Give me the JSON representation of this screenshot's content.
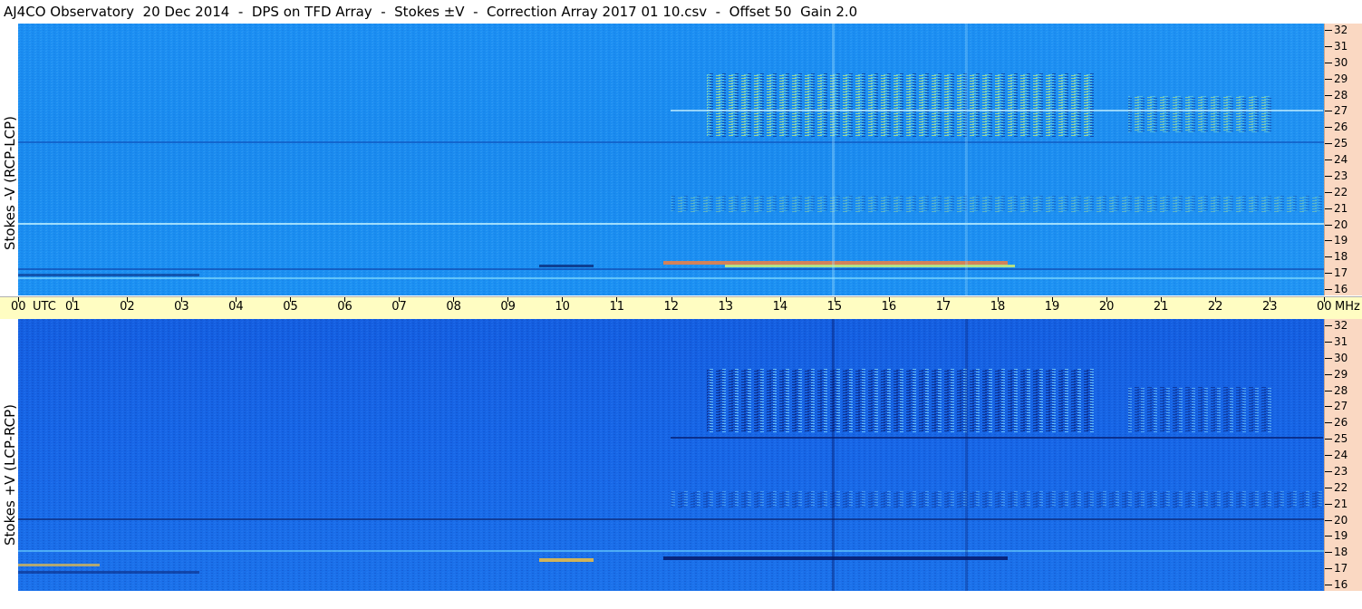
{
  "title": "AJ4CO Observatory  20 Dec 2014  -  DPS on TFD Array  -  Stokes ±V  -  Correction Array 2017 01 10.csv  -  Offset 50  Gain 2.0",
  "top_panel": {
    "ylabel": "Stokes -V (RCP-LCP)"
  },
  "bottom_panel": {
    "ylabel": "Stokes +V (LCP-RCP)"
  },
  "time_axis": {
    "unit": "UTC",
    "freq_unit": "MHz",
    "hours": [
      "00",
      "01",
      "02",
      "03",
      "04",
      "05",
      "06",
      "07",
      "08",
      "09",
      "10",
      "11",
      "12",
      "13",
      "14",
      "15",
      "16",
      "17",
      "18",
      "19",
      "20",
      "21",
      "22",
      "23",
      "00"
    ]
  },
  "freq_axis": {
    "labels": [
      "32",
      "31",
      "30",
      "29",
      "28",
      "27",
      "26",
      "25",
      "24",
      "23",
      "22",
      "21",
      "20",
      "19",
      "18",
      "17",
      "16"
    ]
  },
  "colors": {
    "top_background": "#1a8cf0",
    "bottom_background": "#1560e0",
    "axis_background": "#fad8c2",
    "timebar_background": "#fffdc2",
    "emission_bright": "#d8f060",
    "emission_dark": "#061a6a"
  }
}
